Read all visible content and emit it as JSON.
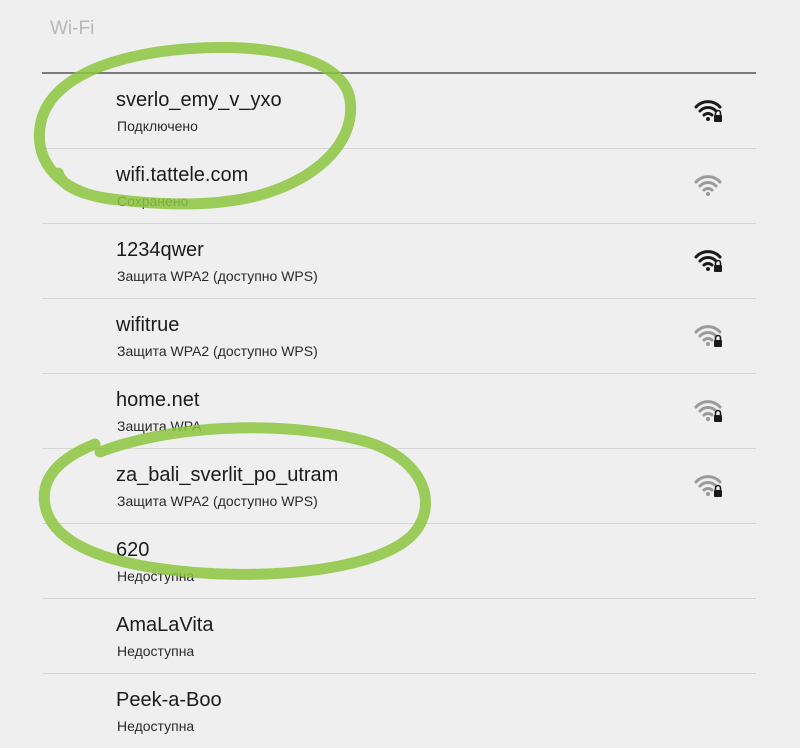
{
  "header": {
    "title": "Wi-Fi"
  },
  "colors": {
    "background": "#efefef",
    "signal_strong": "#1a1a1a",
    "signal_weak": "#9a9a9a",
    "annotation": "#8cc63f"
  },
  "networks": [
    {
      "name": "sverlo_emy_v_yxo",
      "status": "Подключено",
      "signal_icon": "wifi-lock-icon",
      "signal_color": "#1a1a1a"
    },
    {
      "name": "wifi.tattele.com",
      "status": "Сохранено",
      "signal_icon": "wifi-icon",
      "signal_color": "#9a9a9a"
    },
    {
      "name": "1234qwer",
      "status": "Защита WPA2 (доступно WPS)",
      "signal_icon": "wifi-lock-icon",
      "signal_color": "#1a1a1a"
    },
    {
      "name": "wifitrue",
      "status": "Защита WPA2 (доступно WPS)",
      "signal_icon": "wifi-lock-icon",
      "signal_color": "#9a9a9a"
    },
    {
      "name": "home.net",
      "status": "Защита WPA",
      "signal_icon": "wifi-lock-icon",
      "signal_color": "#9a9a9a"
    },
    {
      "name": "za_bali_sverlit_po_utram",
      "status": "Защита WPA2 (доступно WPS)",
      "signal_icon": "wifi-lock-icon",
      "signal_color": "#9a9a9a"
    },
    {
      "name": "620",
      "status": "Недоступна"
    },
    {
      "name": "AmaLaVita",
      "status": "Недоступна"
    },
    {
      "name": "Peek-a-Boo",
      "status": "Недоступна"
    }
  ]
}
